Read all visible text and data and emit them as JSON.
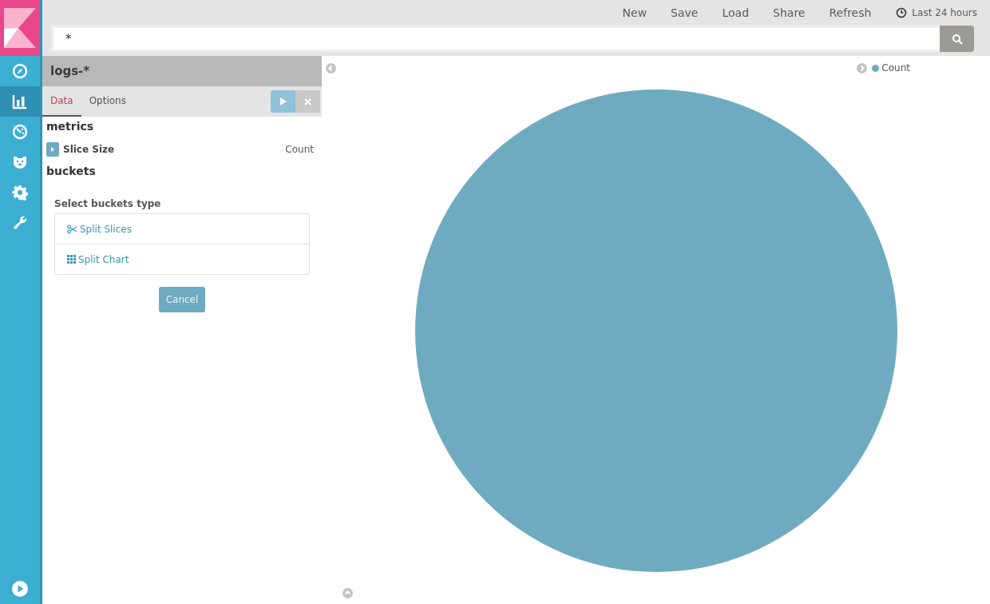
{
  "sidebar": {
    "items": [
      {
        "selected": false
      },
      {
        "selected": true
      },
      {
        "selected": false
      },
      {
        "selected": false
      },
      {
        "selected": false
      },
      {
        "selected": false
      }
    ]
  },
  "top_menu": {
    "items": [
      "New",
      "Save",
      "Load",
      "Share",
      "Refresh"
    ],
    "time_range": "Last 24 hours"
  },
  "search": {
    "value": "*"
  },
  "editor": {
    "title": "logs-*",
    "tabs": [
      {
        "label": "Data",
        "selected": true
      },
      {
        "label": "Options",
        "selected": false
      }
    ],
    "metrics_heading": "metrics",
    "metrics": [
      {
        "label": "Slice Size",
        "value": "Count"
      }
    ],
    "buckets_heading": "buckets",
    "select_label": "Select buckets type",
    "bucket_types": [
      "Split Slices",
      "Split Chart"
    ],
    "cancel": "Cancel"
  },
  "chart": {
    "legend": [
      {
        "label": "Count",
        "color": "#6eabc1"
      }
    ]
  }
}
